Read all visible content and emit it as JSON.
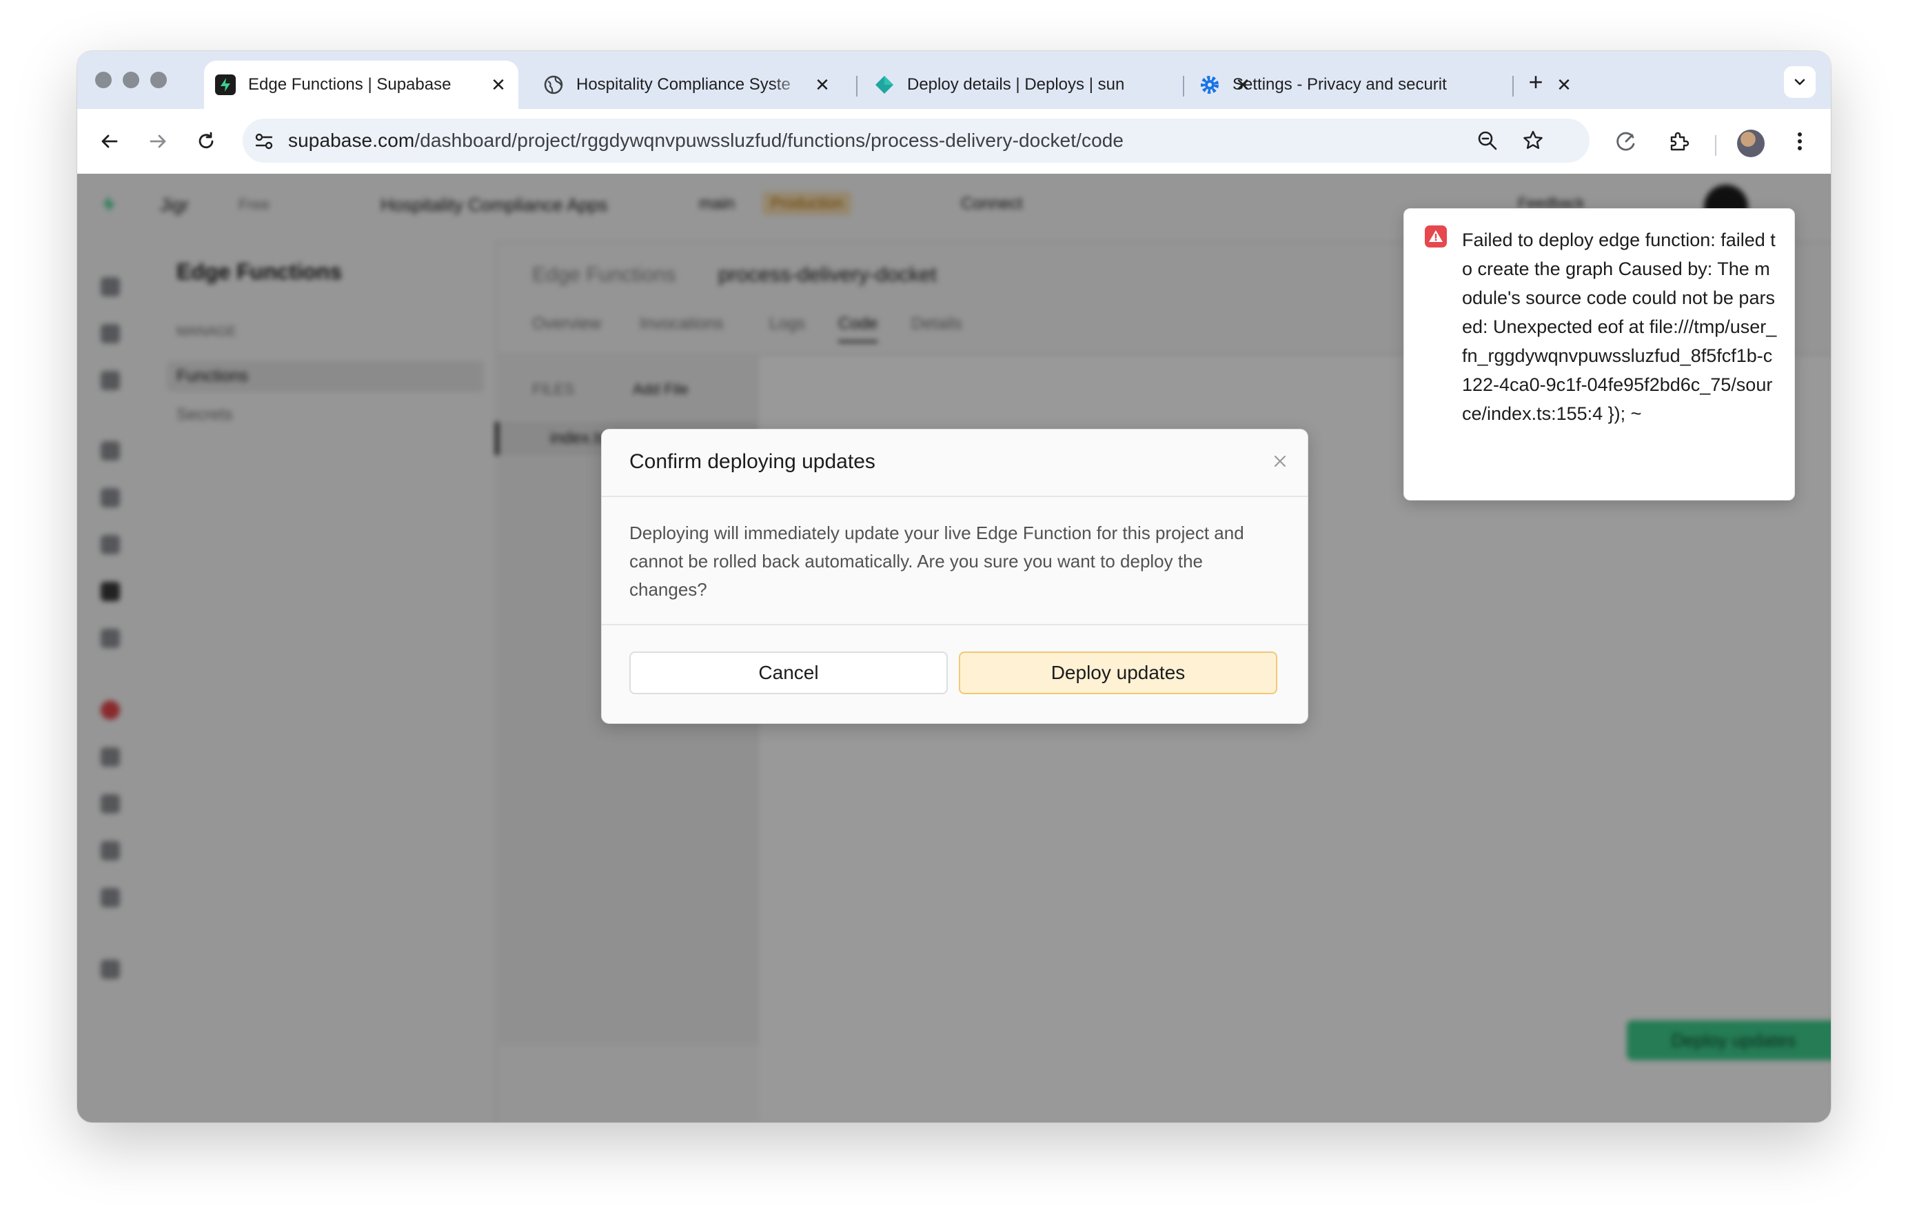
{
  "browser": {
    "tabs": [
      {
        "title": "Edge Functions | Supabase",
        "icon": "supabase-icon",
        "active": true
      },
      {
        "title": "Hospitality Compliance Syste",
        "icon": "globe-icon",
        "active": false
      },
      {
        "title": "Deploy details | Deploys | sun",
        "icon": "netlify-icon",
        "active": false
      },
      {
        "title": "Settings - Privacy and securit",
        "icon": "gear-icon",
        "active": false
      }
    ],
    "new_tab_label": "+",
    "url_host": "supabase.com",
    "url_path": "/dashboard/project/rggdywqnvpuwssluzfud/functions/process-delivery-docket/code"
  },
  "dashboard": {
    "topbar": {
      "org": "Jigr",
      "plan": "Free",
      "project": "Hospitality Compliance Apps",
      "branch": "main",
      "env_badge": "Production",
      "connect": "Connect",
      "feedback": "Feedback"
    },
    "sidebar_title": "Edge Functions",
    "sidebar_section": "MANAGE",
    "sidebar_items": [
      "Functions",
      "Secrets"
    ],
    "breadcrumb": [
      "Edge Functions",
      "process-delivery-docket"
    ],
    "tabs": [
      "Overview",
      "Invocations",
      "Logs",
      "Code",
      "Details"
    ],
    "files_header": "FILES",
    "add_file": "Add File",
    "file_name": "index.ts",
    "deploy_button": "Deploy updates"
  },
  "modal": {
    "title": "Confirm deploying updates",
    "body": "Deploying will immediately update your live Edge Function for this project and cannot be rolled back automatically. Are you sure you want to deploy the changes?",
    "cancel_label": "Cancel",
    "confirm_label": "Deploy updates"
  },
  "toast": {
    "message": "Failed to deploy edge function: failed to create the graph Caused by: The module's source code could not be parsed: Unexpected eof at file:///tmp/user_fn_rggdywqnvpuwssluzfud_8f5fcf1b-c122-4ca0-9c1f-04fe95f2bd6c_75/source/index.ts:155:4 }); ~",
    "icon": "alert-triangle-icon"
  },
  "colors": {
    "accent_green": "#3ecf8e",
    "warning_bg": "#fff1d4",
    "warning_border": "#f3c878",
    "error_red": "#e5484d"
  }
}
